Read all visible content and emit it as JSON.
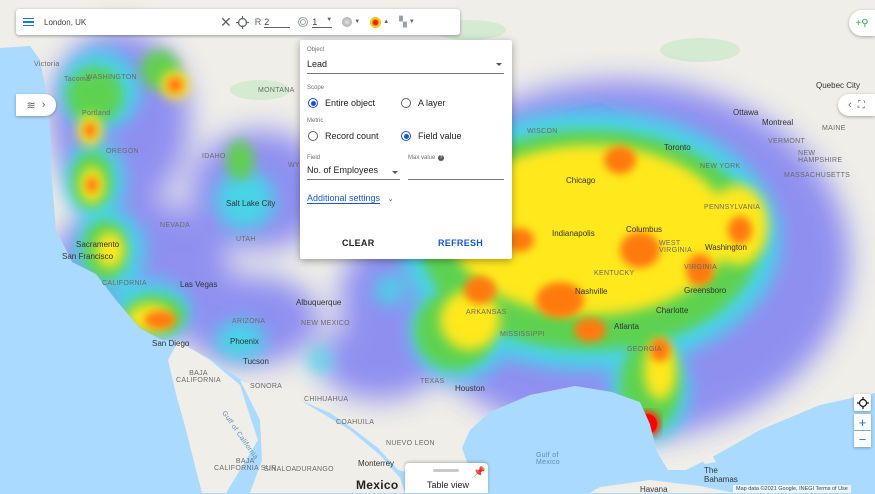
{
  "toolbar": {
    "location": "London, UK",
    "radius_prefix": "R",
    "radius_value": "2",
    "ring_value": "1"
  },
  "panel": {
    "object_label": "Object",
    "object_value": "Lead",
    "scope_label": "Scope",
    "scope_options": [
      "Entire object",
      "A layer"
    ],
    "scope_selected": "Entire object",
    "metric_label": "Metric",
    "metric_options": [
      "Record count",
      "Field value"
    ],
    "metric_selected": "Field value",
    "field_label": "Field",
    "field_value": "No. of Employees",
    "max_value_label": "Max value",
    "additional_settings": "Additional settings",
    "clear_label": "CLEAR",
    "refresh_label": "REFRESH"
  },
  "table_view_label": "Table view",
  "map_labels": {
    "victoria": "Victoria",
    "tacoma": "Tacoma",
    "washington": "WASHINGTON",
    "portland": "Portland",
    "oregon": "OREGON",
    "idaho": "IDAHO",
    "montana": "MONTANA",
    "wy": "WY",
    "nevada": "NEVADA",
    "utah": "UTAH",
    "salt_lake": "Salt Lake City",
    "sacramento": "Sacramento",
    "san_francisco": "San Francisco",
    "california": "CALIFORNIA",
    "las_vegas": "Las Vegas",
    "arizona": "ARIZONA",
    "new_mexico": "NEW MEXICO",
    "albuquerque": "Albuquerque",
    "phoenix": "Phoenix",
    "tucson": "Tucson",
    "san_diego": "San Diego",
    "baja_california": "BAJA\nCALIFORNIA",
    "sonora": "SONORA",
    "chihuahua": "CHIHUAHUA",
    "coahuila": "COAHUILA",
    "nuevo_leon": "NUEVO LEON",
    "baja_california_sur": "BAJA\nCALIFORNIA SUR",
    "sinaloa": "SINALOA",
    "durango": "DURANGO",
    "monterrey": "Monterrey",
    "mexico": "Mexico",
    "gulf_of_california": "Gulf of California",
    "gulf_of_mexico": "Gulf of\nMexico",
    "texas": "TEXAS",
    "houston": "Houston",
    "havana": "Havana",
    "bahamas": "The\nBahamas",
    "quebec_city": "Quebec City",
    "ottawa": "Ottawa",
    "montreal": "Montreal",
    "toronto": "Toronto",
    "vermont": "VERMONT",
    "maine": "MAINE",
    "new_hampshire": "NEW\nHAMPSHIRE",
    "massachusetts": "MASSACHUSETTS",
    "new_york": "NEW YORK",
    "pennsylvania": "PENNSYLVANIA",
    "columbus": "Columbus",
    "indianapolis": "Indianapolis",
    "chicago": "Chicago",
    "wisconsin": "WISCON",
    "west_virginia": "WEST\nVIRGINIA",
    "virginia": "VIRGINIA",
    "washington_dc": "Washington",
    "kentucky": "KENTUCKY",
    "nashville": "Nashville",
    "atlanta": "Atlanta",
    "mississippi": "MISSISSIPPI",
    "arkansas": "ARKANSAS",
    "georgia": "GEORGIA",
    "charlotte": "Charlotte",
    "greensboro": "Greensboro"
  },
  "attribution": "Map data ©2021 Google, INEGI   Terms of Use",
  "colors": {
    "accent": "#1a73e8",
    "heat_hot": "#ff0000",
    "heat_mid": "#ffee00",
    "heat_cool": "#7c7cf0",
    "water": "#aadaff",
    "land": "#efeee8"
  }
}
